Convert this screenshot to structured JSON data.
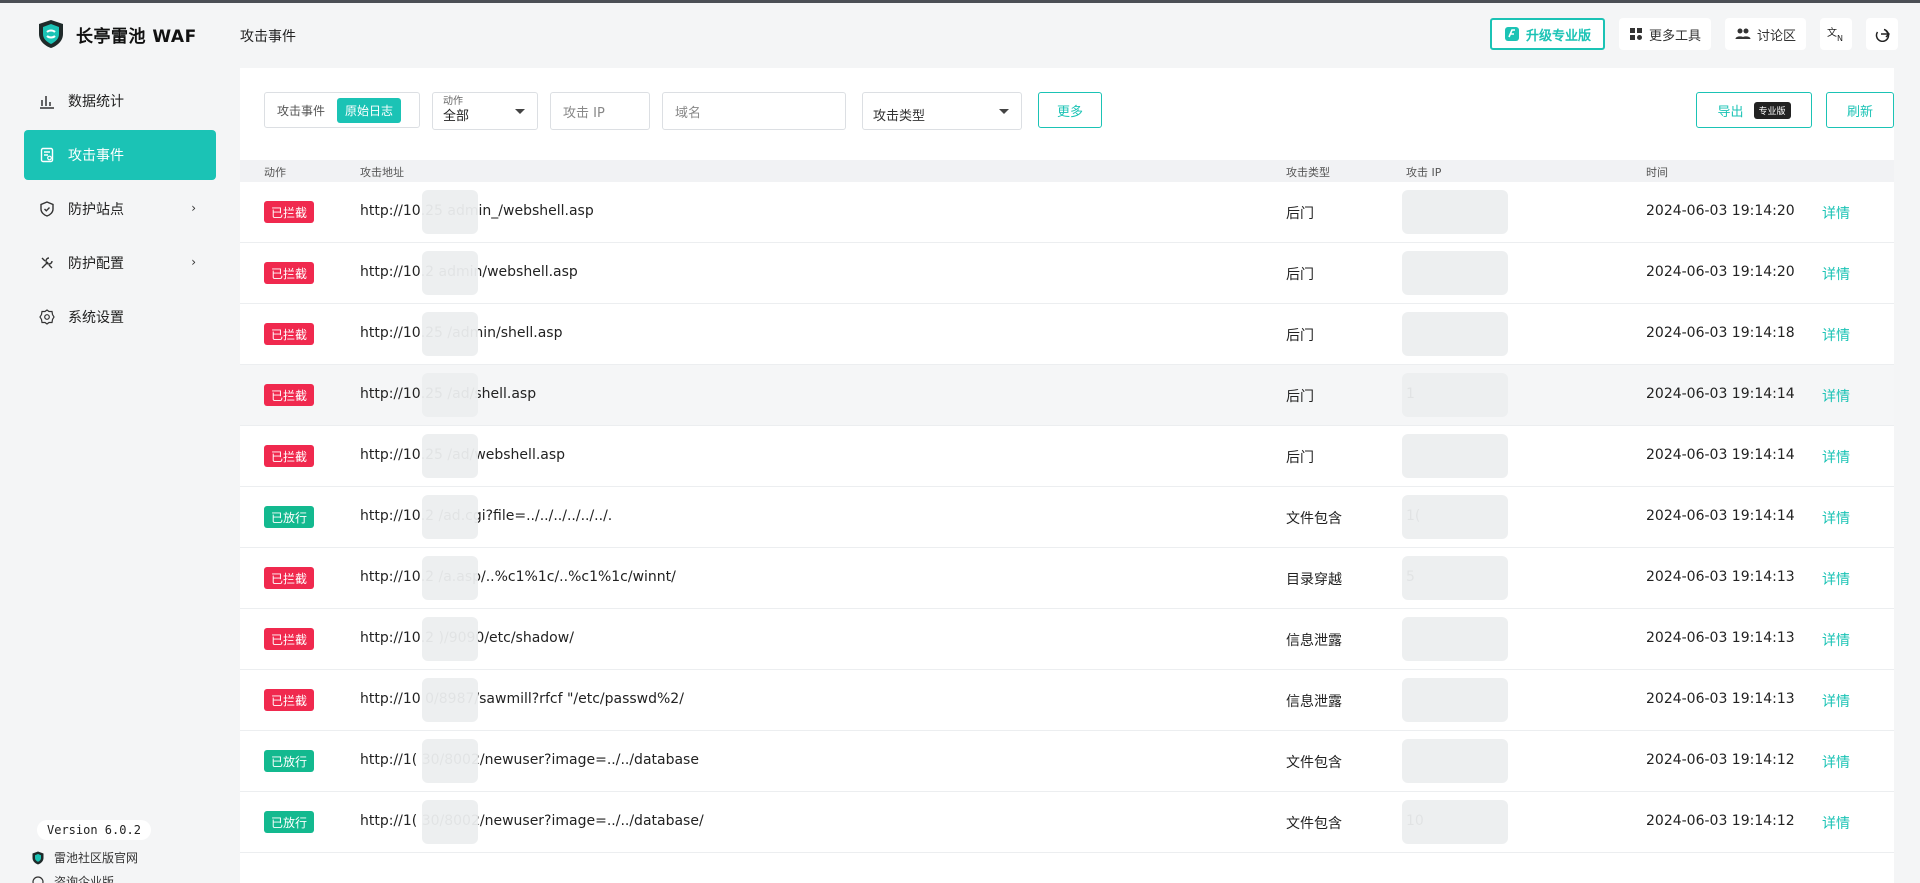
{
  "app": {
    "name": "长亭雷池 WAF"
  },
  "sidebar": {
    "items": [
      {
        "label": "数据统计",
        "icon": "bar-chart-icon",
        "active": false,
        "has_children": false
      },
      {
        "label": "攻击事件",
        "icon": "document-icon",
        "active": true,
        "has_children": false
      },
      {
        "label": "防护站点",
        "icon": "shield-icon",
        "active": false,
        "has_children": true
      },
      {
        "label": "防护配置",
        "icon": "tools-icon",
        "active": false,
        "has_children": true
      },
      {
        "label": "系统设置",
        "icon": "gear-icon",
        "active": false,
        "has_children": false
      }
    ],
    "version": "Version 6.0.2",
    "community_link": "雷池社区版官网",
    "enterprise_link": "咨询企业版"
  },
  "header": {
    "title": "攻击事件",
    "upgrade": "升级专业版",
    "more_tools": "更多工具",
    "forum": "讨论区"
  },
  "filters": {
    "tab_events": "攻击事件",
    "tab_raw_logs": "原始日志",
    "action_label": "动作",
    "action_value": "全部",
    "ip_placeholder": "攻击 IP",
    "domain_placeholder": "域名",
    "type_placeholder": "攻击类型",
    "more": "更多",
    "export": "导出",
    "export_badge": "专业版",
    "refresh": "刷新"
  },
  "table": {
    "headers": {
      "action": "动作",
      "url": "攻击地址",
      "type": "攻击类型",
      "ip": "攻击 IP",
      "time": "时间"
    },
    "rows": [
      {
        "action": "已拦截",
        "status": "block",
        "url": "http://10.25            admin_/webshell.asp",
        "type": "后门",
        "ip": "",
        "time": "2024-06-03 19:14:20",
        "detail": "详情"
      },
      {
        "action": "已拦截",
        "status": "block",
        "url": "http://10.2             admin/webshell.asp",
        "type": "后门",
        "ip": "",
        "time": "2024-06-03 19:14:20",
        "detail": "详情"
      },
      {
        "action": "已拦截",
        "status": "block",
        "url": "http://10.25           /admin/shell.asp",
        "type": "后门",
        "ip": "",
        "time": "2024-06-03 19:14:18",
        "detail": "详情"
      },
      {
        "action": "已拦截",
        "status": "block",
        "url": "http://10.25           /ad/shell.asp",
        "type": "后门",
        "ip": "1",
        "time": "2024-06-03 19:14:14",
        "detail": "详情"
      },
      {
        "action": "已拦截",
        "status": "block",
        "url": "http://10.25           /ad/webshell.asp",
        "type": "后门",
        "ip": "",
        "time": "2024-06-03 19:14:14",
        "detail": "详情"
      },
      {
        "action": "已放行",
        "status": "pass",
        "url": "http://10.2             /ad.cgi?file=../../../../../../.",
        "type": "文件包含",
        "ip": "1(",
        "time": "2024-06-03 19:14:14",
        "detail": "详情"
      },
      {
        "action": "已拦截",
        "status": "block",
        "url": "http://10.2             /a.asp/..%c1%1c/..%c1%1c/winnt/",
        "type": "目录穿越",
        "ip": "5",
        "time": "2024-06-03 19:14:13",
        "detail": "详情"
      },
      {
        "action": "已拦截",
        "status": "block",
        "url": "http://10.2            )/9090/etc/shadow/",
        "type": "信息泄露",
        "ip": "",
        "time": "2024-06-03 19:14:13",
        "detail": "详情"
      },
      {
        "action": "已拦截",
        "status": "block",
        "url": "http://10            0/8987/sawmill?rfcf \"/etc/passwd%2/",
        "type": "信息泄露",
        "ip": "",
        "time": "2024-06-03 19:14:13",
        "detail": "详情"
      },
      {
        "action": "已放行",
        "status": "pass",
        "url": "http://1(            30/8002/newuser?image=../../database",
        "type": "文件包含",
        "ip": "",
        "time": "2024-06-03 19:14:12",
        "detail": "详情"
      },
      {
        "action": "已放行",
        "status": "pass",
        "url": "http://1(            30/8002/newuser?image=../../database/",
        "type": "文件包含",
        "ip": "10",
        "time": "2024-06-03 19:14:12",
        "detail": "详情"
      }
    ]
  },
  "colors": {
    "accent": "#1bc3b5",
    "block": "#f0294e",
    "pass": "#13b98f"
  }
}
